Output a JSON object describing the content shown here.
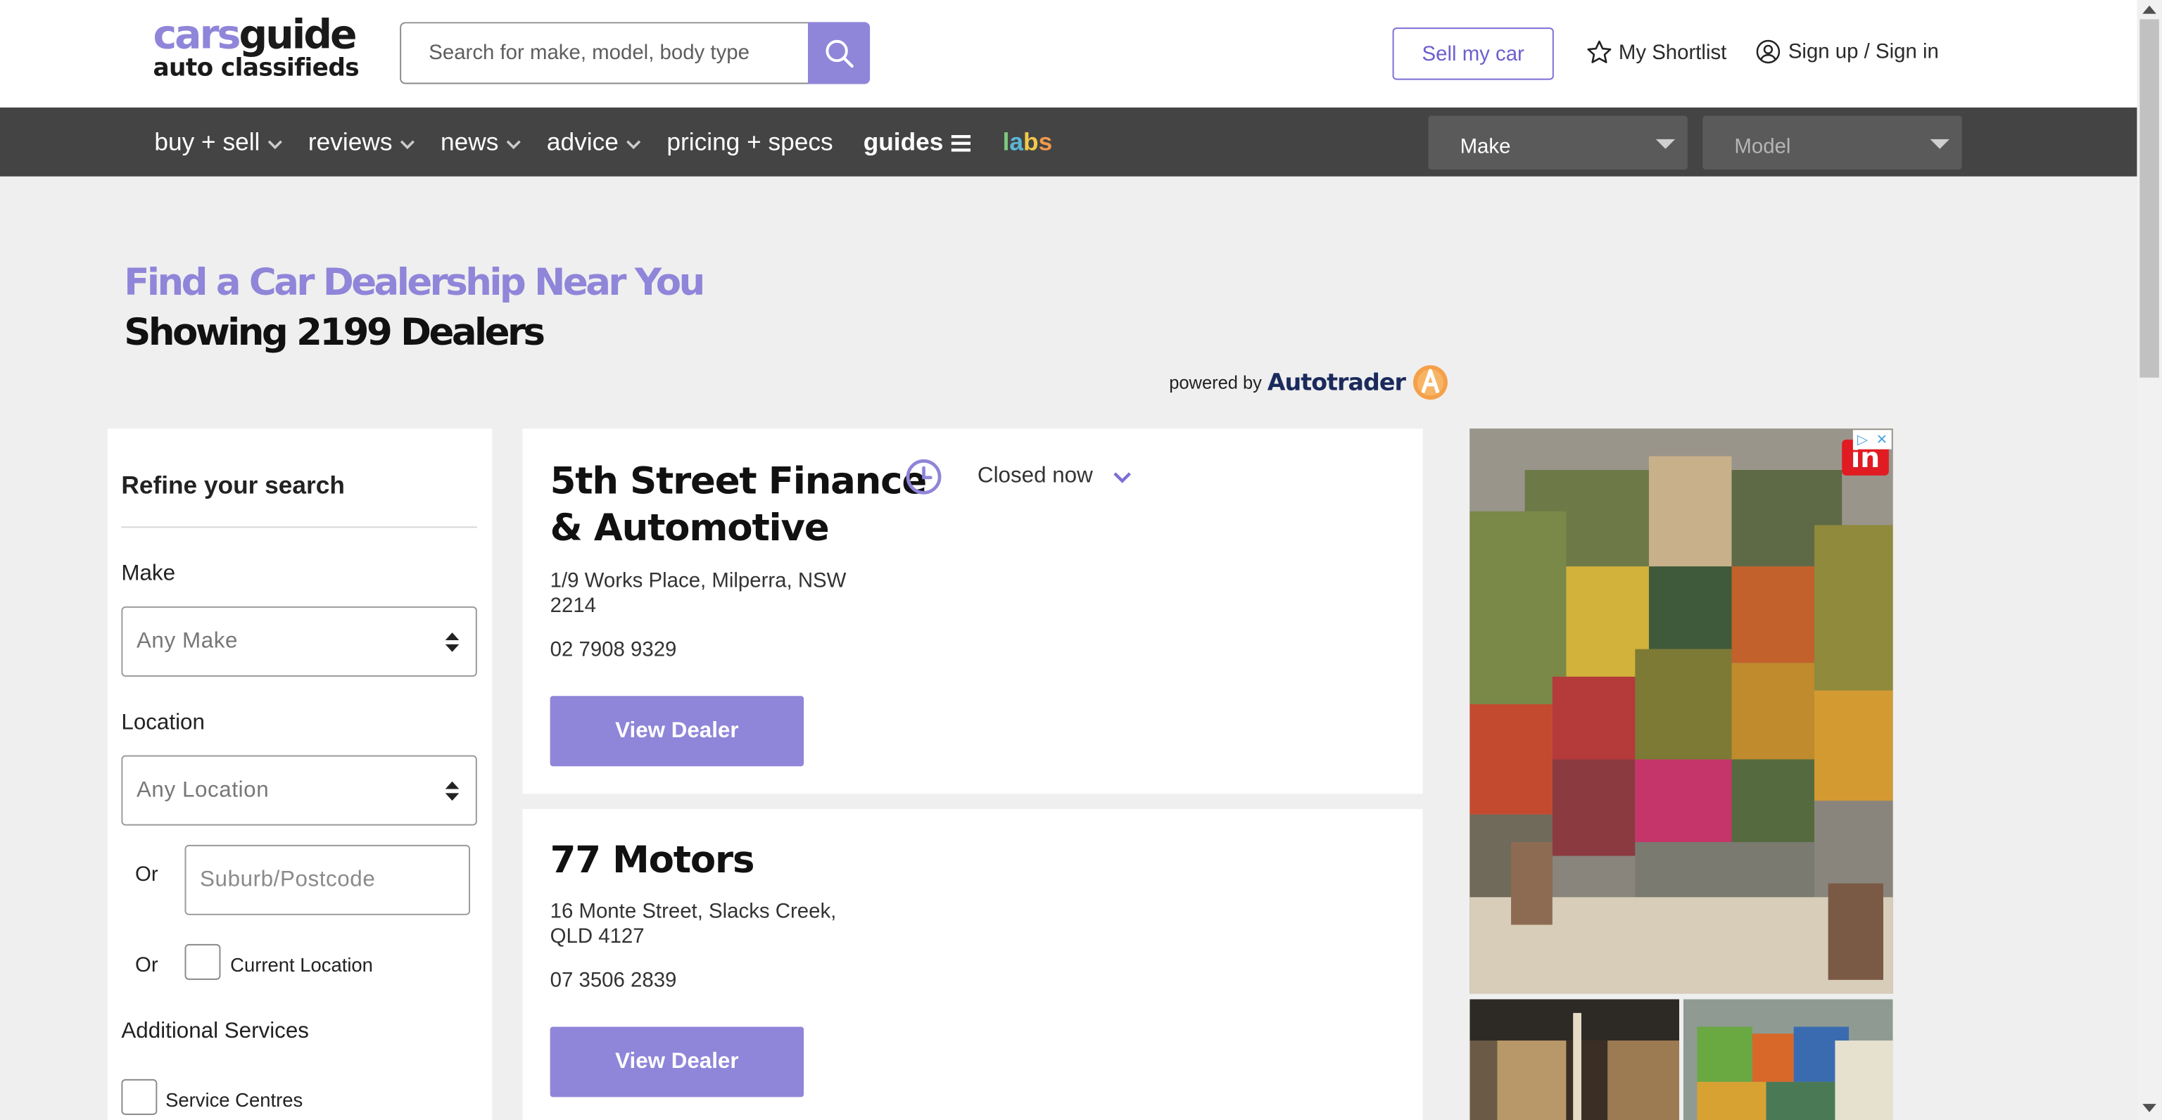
{
  "header": {
    "logo_top_a": "cars",
    "logo_top_b": "guide",
    "logo_bottom": "auto classifieds",
    "search_placeholder": "Search for make, model, body type",
    "sell_label": "Sell my car",
    "shortlist_label": "My Shortlist",
    "signin_label": "Sign up / Sign in"
  },
  "nav": {
    "items": [
      {
        "label": "buy + sell",
        "has_chevron": true
      },
      {
        "label": "reviews",
        "has_chevron": true
      },
      {
        "label": "news",
        "has_chevron": true
      },
      {
        "label": "advice",
        "has_chevron": true
      },
      {
        "label": "pricing + specs",
        "has_chevron": false
      }
    ],
    "guides_label": "guides",
    "labs": [
      "l",
      "a",
      "b",
      "s"
    ],
    "make_select": "Make",
    "model_select": "Model"
  },
  "page": {
    "title": "Find a Car Dealership Near You",
    "subtitle": "Showing 2199 Dealers",
    "powered_by": "powered by",
    "powered_brand": "Autotrader"
  },
  "filters": {
    "title": "Refine your search",
    "make_label": "Make",
    "make_value": "Any Make",
    "location_label": "Location",
    "location_value": "Any Location",
    "or_1": "Or",
    "suburb_placeholder": "Suburb/Postcode",
    "or_2": "Or",
    "current_location_label": "Current Location",
    "additional_label": "Additional Services",
    "service_centres_label": "Service Centres"
  },
  "dealers": [
    {
      "name_line1": "5th Street Finance",
      "name_line2": "& Automotive",
      "address_line1": "1/9 Works Place, Milperra, NSW",
      "address_line2": "2214",
      "phone": "02 7908 9329",
      "status": "Closed now",
      "button": "View Dealer"
    },
    {
      "name_line1": "77 Motors",
      "address_line1": "16 Monte Street, Slacks Creek,",
      "address_line2": "QLD 4127",
      "phone": "07 3506 2839",
      "button": "View Dealer"
    }
  ],
  "ad": {
    "badge": "in",
    "choices_icon": "adchoices-icon",
    "close_icon": "close-icon"
  },
  "colors": {
    "brand_purple": "#8f85d9",
    "nav_bg": "#444444",
    "page_bg": "#efefef"
  }
}
